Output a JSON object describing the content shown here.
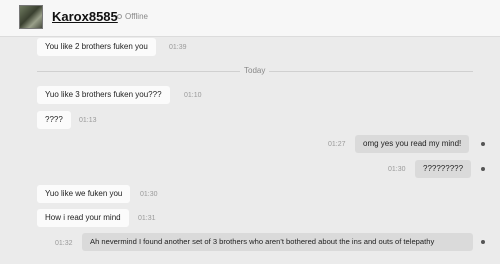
{
  "contact": {
    "name": "Karox8585",
    "status": "Offline"
  },
  "divider_label": "Today",
  "messages": [
    {
      "text": "You like 2 brothers fuken you",
      "time": "01:39"
    },
    {
      "text": "Yuo like  3 brothers fuken you???",
      "time": "01:10"
    },
    {
      "text": "????",
      "time": "01:13"
    },
    {
      "text": "omg yes you read my mind!",
      "time": "01:27"
    },
    {
      "text": "?????????",
      "time": "01:30"
    },
    {
      "text": "Yuo like we fuken you",
      "time": "01:30"
    },
    {
      "text": "How i read your mind",
      "time": "01:31"
    },
    {
      "text": "Ah nevermind I found another set of 3 brothers who aren't bothered about the ins and outs of telepathy",
      "time": "01:32"
    }
  ]
}
